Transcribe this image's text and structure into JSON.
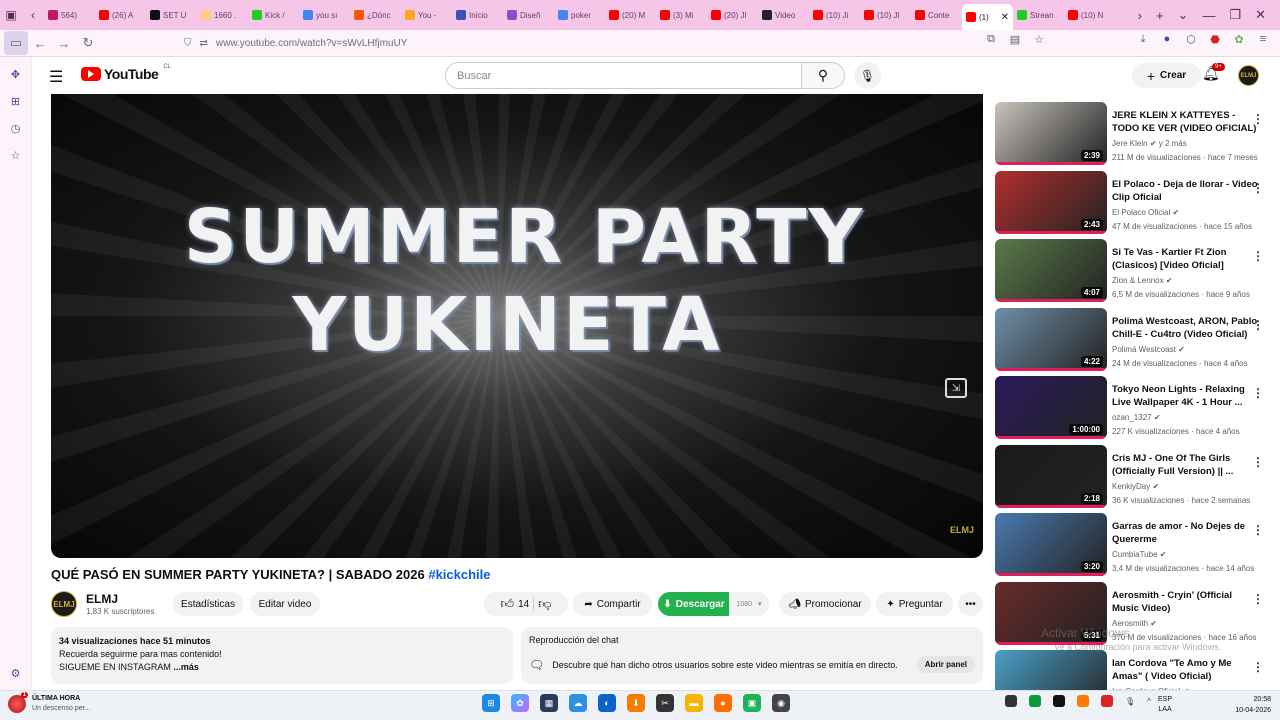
{
  "browser": {
    "tabs": [
      {
        "label": "564)",
        "color": "#c2185b"
      },
      {
        "label": "(26) A",
        "color": "#ff0000"
      },
      {
        "label": "SET U",
        "color": "#111111"
      },
      {
        "label": "1660 .",
        "color": "#ffcc80"
      },
      {
        "label": "Kick /",
        "color": "#22cc22"
      },
      {
        "label": "you sı",
        "color": "#4285f4"
      },
      {
        "label": "¿Dónc",
        "color": "#ff5700"
      },
      {
        "label": "You -",
        "color": "#f9a825"
      },
      {
        "label": "Inicio",
        "color": "#3f51b5"
      },
      {
        "label": "Diseñ",
        "color": "#7e57c2"
      },
      {
        "label": "poker",
        "color": "#4285f4"
      },
      {
        "label": "(20) M",
        "color": "#ff0000"
      },
      {
        "label": "(3) Mi",
        "color": "#ff0000"
      },
      {
        "label": "(20) Jl",
        "color": "#ff0000"
      },
      {
        "label": "Video",
        "color": "#222222"
      },
      {
        "label": "(10) Ji",
        "color": "#ff0000"
      },
      {
        "label": "(10) Jl",
        "color": "#ff0000"
      },
      {
        "label": "Conte",
        "color": "#ff0000"
      },
      {
        "label": "(1)",
        "color": "#ff0000",
        "active": true
      },
      {
        "label": "Strean",
        "color": "#22cc22"
      },
      {
        "label": "(10) N",
        "color": "#ff0000"
      }
    ],
    "url": "www.youtube.com/watch?v=sWvLHfjmuUY"
  },
  "header": {
    "logo_text": "YouTube",
    "country": "CL",
    "search_placeholder": "Buscar",
    "create_label": "Crear",
    "notif_badge": "9+",
    "avatar_text": "ELMJ"
  },
  "video": {
    "line1": "SUMMER PARTY",
    "line2": "YUKINETA",
    "watermark": "ELMJ",
    "title": "QUÉ PASÓ EN SUMMER PARTY YUKINETA? | SABADO 2026 ",
    "hashtag": "#kickchile"
  },
  "channel": {
    "avatar_text": "ELMJ",
    "name": "ELMJ",
    "subs": "1,83 K suscriptores",
    "stats_btn": "Estadísticas",
    "edit_btn": "Editar video",
    "likes": "14",
    "share": "Compartir",
    "download": "Descargar",
    "quality": "1080",
    "promote": "Promocionar",
    "ask": "Preguntar"
  },
  "description": {
    "stats": "34 visualizaciones  hace 51 minutos",
    "line1": "Recuerda seguirme para mas contenido!",
    "line2": "SIGUEME EN INSTAGRAM",
    "more": " ...más"
  },
  "chat": {
    "title": "Reproducción del chat",
    "text": "Descubre qué han dicho otros usuarios sobre este video mientras se emitía en directo.",
    "button": "Abrir panel"
  },
  "related": [
    {
      "title": "JERE KLEIN X KATTEYES - TODO KE VER (VIDEO OFICIAL)",
      "channel": "Jere Klein",
      "extra": "y 2 más",
      "meta": "211 M de visualizaciones · hace 7 meses",
      "duration": "2:39",
      "color": "#c9c4bd"
    },
    {
      "title": "El Polaco - Deja de llorar - Video Clip Oficial",
      "channel": "El Polaco Oficial",
      "extra": "",
      "meta": "47 M de visualizaciones · hace 15 años",
      "duration": "2:43",
      "color": "#b0302e"
    },
    {
      "title": "Si Te Vas - Kartier Ft Zion (Clasicos) [Video Oficial]",
      "channel": "Zion & Lennox",
      "extra": "",
      "meta": "6,5 M de visualizaciones · hace 9 años",
      "duration": "4:07",
      "color": "#5a7a4a"
    },
    {
      "title": "Polimá Westcoast, ARON, Pablo Chill-E - Cu4tro (Video Oficial)",
      "channel": "Polimá Westcoast",
      "extra": "",
      "meta": "24 M de visualizaciones · hace 4 años",
      "duration": "4:22",
      "color": "#6f8fa8"
    },
    {
      "title": "Tokyo Neon Lights - Relaxing Live Wallpaper 4K - 1 Hour ...",
      "channel": "ozan_1327",
      "extra": "",
      "meta": "227 K visualizaciones · hace 4 años",
      "duration": "1:00:00",
      "color": "#2a1a5a"
    },
    {
      "title": "Cris MJ - One Of The Girls (Officially Full Version) || ...",
      "channel": "KenkiyDay",
      "extra": "",
      "meta": "36 K visualizaciones · hace 2 semanas",
      "duration": "2:18",
      "color": "#1a1a1a"
    },
    {
      "title": "Garras de amor - No Dejes de Quererme",
      "channel": "CumbiaTube",
      "extra": "",
      "meta": "3,4 M de visualizaciones · hace 14 años",
      "duration": "3:20",
      "color": "#4a7ab0"
    },
    {
      "title": "Aerosmith - Cryin' (Official Music Video)",
      "channel": "Aerosmith",
      "extra": "",
      "meta": "370 M de visualizaciones · hace 16 años",
      "duration": "5:31",
      "color": "#6a2a2a"
    },
    {
      "title": "Ian Cordova \"Te Amo y Me Amas\" ( Video Oficial)",
      "channel": "Ian Cordova Oficial",
      "extra": "",
      "meta": "",
      "duration": "",
      "color": "#4aa0c8"
    }
  ],
  "overlay": {
    "activate_title": "Activar Windows",
    "activate_sub": "Ve a Configuración para activar Windows."
  },
  "taskbar": {
    "news_title": "ÚLTIMA HORA",
    "news_sub": "Un descenso per...",
    "news_badge": "1",
    "lang1": "ESP",
    "lang2": "LAA",
    "time": "20:58",
    "date": "10-04-2026"
  }
}
